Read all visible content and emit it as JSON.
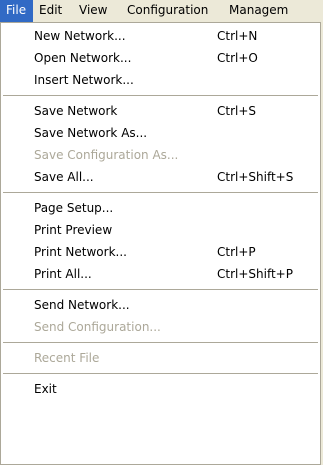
{
  "menubar": {
    "items": [
      {
        "label": "File",
        "active": true
      },
      {
        "label": "Edit"
      },
      {
        "label": "View"
      },
      {
        "label": "Configuration"
      },
      {
        "label": "Managem"
      }
    ]
  },
  "file_menu": {
    "new_network": {
      "label": "New Network...",
      "shortcut": "Ctrl+N"
    },
    "open_network": {
      "label": "Open Network...",
      "shortcut": "Ctrl+O"
    },
    "insert_network": {
      "label": "Insert Network..."
    },
    "save_network": {
      "label": "Save Network",
      "shortcut": "Ctrl+S"
    },
    "save_network_as": {
      "label": "Save Network As..."
    },
    "save_configuration_as": {
      "label": "Save Configuration As...",
      "enabled": false
    },
    "save_all": {
      "label": "Save All...",
      "shortcut": "Ctrl+Shift+S"
    },
    "page_setup": {
      "label": "Page Setup..."
    },
    "print_preview": {
      "label": "Print Preview"
    },
    "print_network": {
      "label": "Print Network...",
      "shortcut": "Ctrl+P"
    },
    "print_all": {
      "label": "Print All...",
      "shortcut": "Ctrl+Shift+P"
    },
    "send_network": {
      "label": "Send Network..."
    },
    "send_configuration": {
      "label": "Send Configuration...",
      "enabled": false
    },
    "recent_file": {
      "label": "Recent File",
      "enabled": false
    },
    "exit": {
      "label": "Exit"
    }
  },
  "colors": {
    "highlight": "#316ac5",
    "menu_background": "#ffffff",
    "bar_background": "#ece9d8",
    "disabled_text": "#aca899",
    "separator": "#aca899"
  }
}
